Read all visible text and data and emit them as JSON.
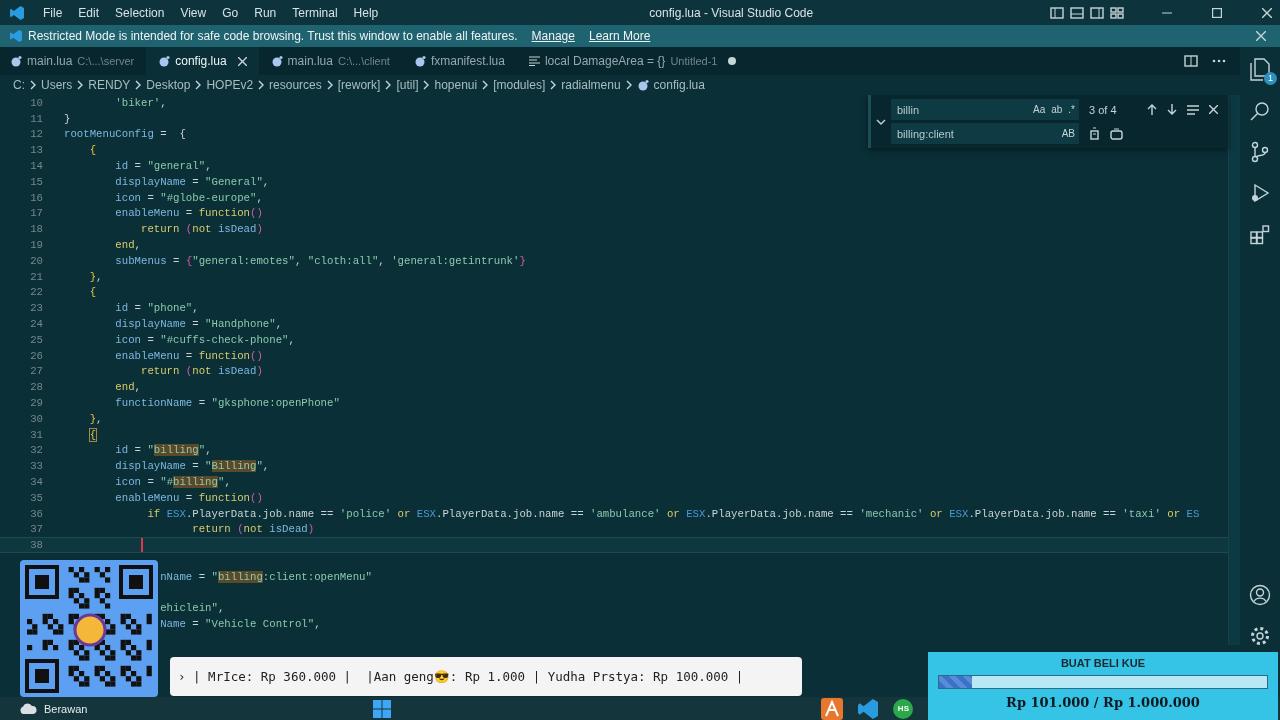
{
  "title_bar": {
    "menus": [
      "File",
      "Edit",
      "Selection",
      "View",
      "Go",
      "Run",
      "Terminal",
      "Help"
    ],
    "title": "config.lua - Visual Studio Code"
  },
  "banner": {
    "message": "Restricted Mode is intended for safe code browsing. Trust this window to enable all features.",
    "links": [
      "Manage",
      "Learn More"
    ]
  },
  "tabs": [
    {
      "label": "main.lua",
      "description": "C:\\...\\server",
      "kind": "lua",
      "selected": false,
      "dirty": false
    },
    {
      "label": "config.lua",
      "kind": "lua",
      "selected": true,
      "dirty": false
    },
    {
      "label": "main.lua",
      "description": "C:\\...\\client",
      "kind": "lua",
      "selected": false,
      "dirty": false
    },
    {
      "label": "fxmanifest.lua",
      "kind": "lua",
      "selected": false,
      "dirty": false
    },
    {
      "label": "local DamageArea = {}",
      "description": "Untitled-1",
      "kind": "text",
      "selected": false,
      "dirty": true
    }
  ],
  "breadcrumb": [
    "C:",
    "Users",
    "RENDY",
    "Desktop",
    "HOPEv2",
    "resources",
    "[rework]",
    "[util]",
    "hopenui",
    "[modules]",
    "radialmenu",
    "config.lua"
  ],
  "editor": {
    "lines": [
      {
        "number": "10",
        "current": false,
        "tokens": [
          {
            "kind": "string",
            "text": "        'biker'"
          },
          {
            "kind": "punct",
            "text": ","
          }
        ]
      },
      {
        "number": "11",
        "current": false,
        "tokens": [
          {
            "kind": "punct",
            "text": "}"
          }
        ]
      },
      {
        "number": "12",
        "current": false,
        "tokens": [
          {
            "kind": "variable",
            "text": "rootMenuConfig"
          },
          {
            "kind": "punct",
            "text": " =  {"
          }
        ]
      },
      {
        "number": "13",
        "current": false,
        "tokens": [
          {
            "kind": "bracket1",
            "text": "    {"
          }
        ]
      },
      {
        "number": "14",
        "current": false,
        "tokens": [
          {
            "kind": "variable",
            "text": "        id"
          },
          {
            "kind": "punct",
            "text": " = "
          },
          {
            "kind": "string",
            "text": "\"general\""
          },
          {
            "kind": "punct",
            "text": ","
          }
        ]
      },
      {
        "number": "15",
        "current": false,
        "tokens": [
          {
            "kind": "variable",
            "text": "        displayName"
          },
          {
            "kind": "punct",
            "text": " = "
          },
          {
            "kind": "string",
            "text": "\"General\""
          },
          {
            "kind": "punct",
            "text": ","
          }
        ]
      },
      {
        "number": "16",
        "current": false,
        "tokens": [
          {
            "kind": "variable",
            "text": "        icon"
          },
          {
            "kind": "punct",
            "text": " = "
          },
          {
            "kind": "string",
            "text": "\"#globe-europe\""
          },
          {
            "kind": "punct",
            "text": ","
          }
        ]
      },
      {
        "number": "17",
        "current": false,
        "tokens": [
          {
            "kind": "variable",
            "text": "        enableMenu"
          },
          {
            "kind": "punct",
            "text": " = "
          },
          {
            "kind": "keyword",
            "text": "function"
          },
          {
            "kind": "bracket2",
            "text": "()"
          }
        ]
      },
      {
        "number": "18",
        "current": false,
        "tokens": [
          {
            "kind": "keyword",
            "text": "            return"
          },
          {
            "kind": "bracket2",
            "text": " ("
          },
          {
            "kind": "keyword",
            "text": "not"
          },
          {
            "kind": "variable",
            "text": " isDead"
          },
          {
            "kind": "bracket2",
            "text": ")"
          }
        ]
      },
      {
        "number": "19",
        "current": false,
        "tokens": [
          {
            "kind": "keyword",
            "text": "        end"
          },
          {
            "kind": "punct",
            "text": ","
          }
        ]
      },
      {
        "number": "20",
        "current": false,
        "tokens": [
          {
            "kind": "variable",
            "text": "        subMenus"
          },
          {
            "kind": "punct",
            "text": " = "
          },
          {
            "kind": "bracket2",
            "text": "{"
          },
          {
            "kind": "string",
            "text": "\"general:emotes\""
          },
          {
            "kind": "punct",
            "text": ", "
          },
          {
            "kind": "string",
            "text": "\"cloth:all\""
          },
          {
            "kind": "punct",
            "text": ", "
          },
          {
            "kind": "string",
            "text": "'general:getintrunk'"
          },
          {
            "kind": "bracket2",
            "text": "}"
          }
        ]
      },
      {
        "number": "21",
        "current": false,
        "tokens": [
          {
            "kind": "bracket1",
            "text": "    }"
          },
          {
            "kind": "punct",
            "text": ","
          }
        ]
      },
      {
        "number": "22",
        "current": false,
        "tokens": [
          {
            "kind": "bracket1",
            "text": "    {"
          }
        ]
      },
      {
        "number": "23",
        "current": false,
        "tokens": [
          {
            "kind": "variable",
            "text": "        id"
          },
          {
            "kind": "punct",
            "text": " = "
          },
          {
            "kind": "string",
            "text": "\"phone\""
          },
          {
            "kind": "punct",
            "text": ","
          }
        ]
      },
      {
        "number": "24",
        "current": false,
        "tokens": [
          {
            "kind": "variable",
            "text": "        displayName"
          },
          {
            "kind": "punct",
            "text": " = "
          },
          {
            "kind": "string",
            "text": "\"Handphone\""
          },
          {
            "kind": "punct",
            "text": ","
          }
        ]
      },
      {
        "number": "25",
        "current": false,
        "tokens": [
          {
            "kind": "variable",
            "text": "        icon"
          },
          {
            "kind": "punct",
            "text": " = "
          },
          {
            "kind": "string",
            "text": "\"#cuffs-check-phone\""
          },
          {
            "kind": "punct",
            "text": ","
          }
        ]
      },
      {
        "number": "26",
        "current": false,
        "tokens": [
          {
            "kind": "variable",
            "text": "        enableMenu"
          },
          {
            "kind": "punct",
            "text": " = "
          },
          {
            "kind": "keyword",
            "text": "function"
          },
          {
            "kind": "bracket2",
            "text": "()"
          }
        ]
      },
      {
        "number": "27",
        "current": false,
        "tokens": [
          {
            "kind": "keyword",
            "text": "            return"
          },
          {
            "kind": "bracket2",
            "text": " ("
          },
          {
            "kind": "keyword",
            "text": "not"
          },
          {
            "kind": "variable",
            "text": " isDead"
          },
          {
            "kind": "bracket2",
            "text": ")"
          }
        ]
      },
      {
        "number": "28",
        "current": false,
        "tokens": [
          {
            "kind": "keyword",
            "text": "        end"
          },
          {
            "kind": "punct",
            "text": ","
          }
        ]
      },
      {
        "number": "29",
        "current": false,
        "tokens": [
          {
            "kind": "variable",
            "text": "        functionName"
          },
          {
            "kind": "punct",
            "text": " = "
          },
          {
            "kind": "string",
            "text": "\"gksphone:openPhone\""
          }
        ]
      },
      {
        "number": "30",
        "current": false,
        "tokens": [
          {
            "kind": "bracket1",
            "text": "    }"
          },
          {
            "kind": "punct",
            "text": ","
          }
        ]
      },
      {
        "number": "31",
        "current": false,
        "tokens": [
          {
            "kind": "bracket_match",
            "text": "    {"
          }
        ]
      },
      {
        "number": "32",
        "current": false,
        "tokens": [
          {
            "kind": "variable",
            "text": "        id"
          },
          {
            "kind": "punct",
            "text": " = "
          },
          {
            "kind": "string",
            "text": "\""
          },
          {
            "kind": "match",
            "text": "billing"
          },
          {
            "kind": "string",
            "text": "\""
          },
          {
            "kind": "punct",
            "text": ","
          }
        ]
      },
      {
        "number": "33",
        "current": false,
        "tokens": [
          {
            "kind": "variable",
            "text": "        displayName"
          },
          {
            "kind": "punct",
            "text": " = "
          },
          {
            "kind": "string",
            "text": "\""
          },
          {
            "kind": "match",
            "text": "Billing"
          },
          {
            "kind": "string",
            "text": "\""
          },
          {
            "kind": "punct",
            "text": ","
          }
        ]
      },
      {
        "number": "34",
        "current": false,
        "tokens": [
          {
            "kind": "variable",
            "text": "        icon"
          },
          {
            "kind": "punct",
            "text": " = "
          },
          {
            "kind": "string",
            "text": "\"#"
          },
          {
            "kind": "match",
            "text": "billing"
          },
          {
            "kind": "string",
            "text": "\""
          },
          {
            "kind": "punct",
            "text": ","
          }
        ]
      },
      {
        "number": "35",
        "current": false,
        "tokens": [
          {
            "kind": "variable",
            "text": "        enableMenu"
          },
          {
            "kind": "punct",
            "text": " = "
          },
          {
            "kind": "keyword",
            "text": "function"
          },
          {
            "kind": "bracket2",
            "text": "()"
          }
        ]
      },
      {
        "number": "36",
        "current": false,
        "tokens": [
          {
            "kind": "keyword",
            "text": "             if"
          },
          {
            "kind": "object",
            "text": " ESX"
          },
          {
            "kind": "punct",
            "text": ".PlayerData.job.name == "
          },
          {
            "kind": "string",
            "text": "'police'"
          },
          {
            "kind": "keyword",
            "text": " or"
          },
          {
            "kind": "object",
            "text": " ESX"
          },
          {
            "kind": "punct",
            "text": ".PlayerData.job.name == "
          },
          {
            "kind": "string",
            "text": "'ambulance'"
          },
          {
            "kind": "keyword",
            "text": " or"
          },
          {
            "kind": "object",
            "text": " ESX"
          },
          {
            "kind": "punct",
            "text": ".PlayerData.job.name == "
          },
          {
            "kind": "string",
            "text": "'mechanic'"
          },
          {
            "kind": "keyword",
            "text": " or"
          },
          {
            "kind": "object",
            "text": " ESX"
          },
          {
            "kind": "punct",
            "text": ".PlayerData.job.name == "
          },
          {
            "kind": "string",
            "text": "'taxi'"
          },
          {
            "kind": "keyword",
            "text": " or"
          },
          {
            "kind": "object",
            "text": " ES"
          }
        ]
      },
      {
        "number": "37",
        "current": false,
        "tokens": [
          {
            "kind": "keyword",
            "text": "                    return"
          },
          {
            "kind": "bracket2",
            "text": " ("
          },
          {
            "kind": "keyword",
            "text": "not"
          },
          {
            "kind": "variable",
            "text": " isDead"
          },
          {
            "kind": "bracket2",
            "text": ")"
          }
        ]
      },
      {
        "number": "38",
        "current": true
      },
      {
        "current": false
      },
      {
        "current": false,
        "tokens": [
          {
            "kind": "variable",
            "text": "               nName"
          },
          {
            "kind": "punct",
            "text": " = "
          },
          {
            "kind": "string",
            "text": "\""
          },
          {
            "kind": "match",
            "text": "billing"
          },
          {
            "kind": "string",
            "text": ":client:openMenu\""
          }
        ]
      },
      {
        "current": false
      },
      {
        "current": false,
        "tokens": [
          {
            "kind": "string",
            "text": "               ehiclein\""
          },
          {
            "kind": "punct",
            "text": ","
          }
        ]
      },
      {
        "current": false,
        "tokens": [
          {
            "kind": "variable",
            "text": "               Name"
          },
          {
            "kind": "punct",
            "text": " = "
          },
          {
            "kind": "string",
            "text": "\"Vehicle Control\""
          },
          {
            "kind": "punct",
            "text": ","
          }
        ]
      }
    ]
  },
  "find_widget": {
    "find": "billin",
    "find_options": [
      "Aa",
      "ab",
      ".*"
    ],
    "result": "3 of 4",
    "replace": "billing:client",
    "replace_option": "AB"
  },
  "activity_bar": {
    "explorer_badge": "1"
  },
  "taskbar": {
    "weather": "Berawan",
    "app_label": "HS"
  },
  "donation_ticker": {
    "text": "› | MrIce: Rp 360.000 |  |Aan geng😎: Rp 1.000 | Yudha Prstya: Rp 100.000 |"
  },
  "goal": {
    "title": "BUAT BELI KUE",
    "level": 0.101,
    "amount": "Rp 101.000 / Rp 1.000.000"
  }
}
